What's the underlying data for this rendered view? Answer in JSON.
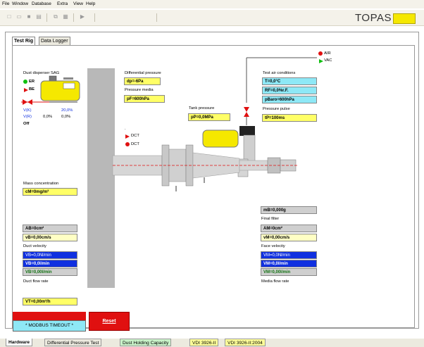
{
  "menu": {
    "items": [
      "File",
      "Window",
      "Database",
      "Extra",
      "View",
      "Help"
    ]
  },
  "toolbar": {
    "brand": "TOPAS"
  },
  "tabs": [
    "Test Rig",
    "Data Logger"
  ],
  "dust_disperser": {
    "title": "Dust disperser SAG",
    "er": "ER",
    "be": "BE",
    "v_k_label": "V(K)",
    "v_r_label": "V(R)",
    "v_k_value": "20,0%",
    "v_r_value1": "0,0%",
    "v_r_value2": "0,0%",
    "status": "Off"
  },
  "differential_pressure": {
    "label": "Differential pressure",
    "value": "dp=-6Pa",
    "media_label": "Pressure media",
    "media_value": "pF=600hPa"
  },
  "tank": {
    "label": "Tank pressure",
    "value": "pP=0,0MPa"
  },
  "test_air": {
    "label": "Test air conditions",
    "t": "T=0,0°C",
    "rf": "RF=0,0%r.F.",
    "pbaro": "pBaro=600hPa",
    "pulse_label": "Pressure pulse",
    "pulse_value": "tP=100ms"
  },
  "air": {
    "air": "AIR",
    "vac": "VAC"
  },
  "dct": {
    "top": "DCT",
    "bottom": "DCT",
    "dot": "."
  },
  "mass": {
    "label": "Mass concentration",
    "value": "cM=0mg/m³"
  },
  "left_bottom": {
    "ab": "AB=0cm²",
    "vb": "vB=0,00cm/s",
    "duct_velocity_label": "Duct velocity",
    "blue1": "VB=0,0Nl/min",
    "blue2": "VB=0,0l/min",
    "blue3": "VB=0,00l/min",
    "duct_flow_label": "Duct flow rate",
    "vt": "VT=0,00m³/h"
  },
  "right_bottom": {
    "mb": "mB=0,000g",
    "final_filter_label": "Final filter",
    "am": "AM=0cm²",
    "vm": "vM=0,00cm/s",
    "face_velocity_label": "Face velocity",
    "blue1": "VM=0,0Nl/min",
    "blue2": "VM=0,0l/min",
    "blue3": "VM=0,00l/min",
    "media_flow_label": "Media flow rate"
  },
  "status": {
    "modbus": "* MODBUS TIMEOUT *",
    "reset": "Reset"
  },
  "bottom_tabs": [
    "Hardware",
    "Differential Pressure Test",
    "Dust Holding Capacity",
    "VDI 3926-II",
    "VDI 3926-II:2004"
  ],
  "colors": {
    "yellow": "#ffff66",
    "cyan": "#8ee8f6",
    "blue": "#1030e0",
    "red": "#e01010",
    "green": "#10c010"
  }
}
